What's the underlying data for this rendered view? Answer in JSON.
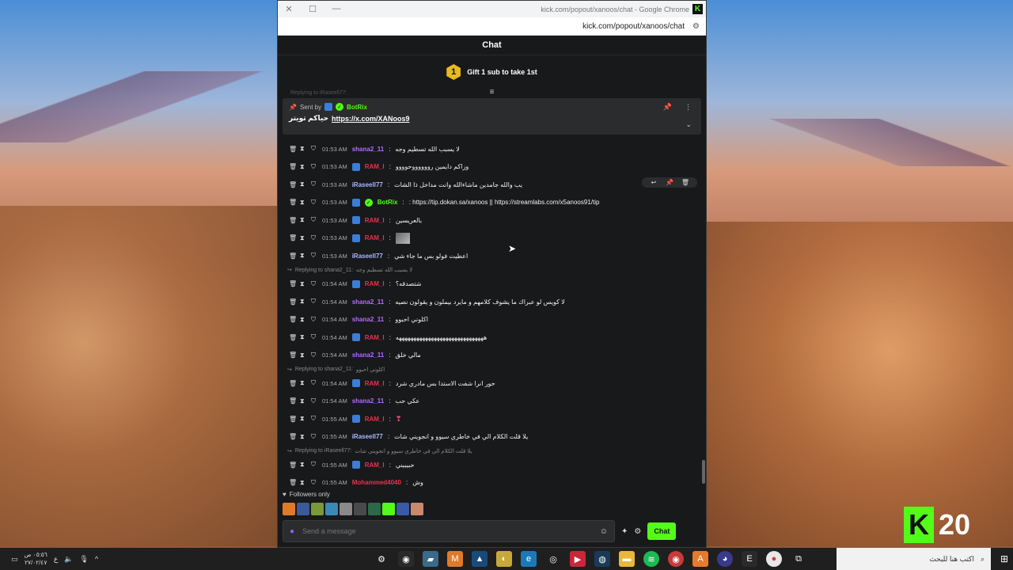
{
  "window": {
    "title": "kick.com/popout/xanoos/chat - Google Chrome",
    "url": "kick.com/popout/xanoos/chat",
    "controls": {
      "close": "✕",
      "maximize": "☐",
      "minimize": "—"
    }
  },
  "chat": {
    "header": "Chat",
    "gift": {
      "badge": "1",
      "text": "Gift 1 sub to take 1st"
    },
    "pinned": {
      "ghost": "Replying to iRaseell77:",
      "sent_by": "Sent by",
      "sender": "BotRix",
      "message_ar": "حياكم تويتر",
      "link": "https://x.com/XANoos9"
    },
    "messages": [
      {
        "type": "msg",
        "time": "01:53 AM",
        "user": "shana2_11",
        "color": "#b36bff",
        "text": "لا يسبب الله تسطيم وجه",
        "badge": false
      },
      {
        "type": "msg",
        "time": "01:53 AM",
        "user": "RAM_I",
        "color": "#e8324e",
        "text": "وزاكم دايمين رووووووحوووو",
        "badge": true
      },
      {
        "type": "msg",
        "time": "01:53 AM",
        "user": "iRaseell77",
        "color": "#aab8ff",
        "text": "يب والله جامدين ماشاءالله وانت مداخل ذا الشات",
        "badge": false,
        "hover": true
      },
      {
        "type": "msg",
        "time": "01:53 AM",
        "user": "BotRix",
        "color": "#53fc18",
        "text": ": https://tip.dokan.sa/xanoos || https://streamlabs.com/x5anoos91/tip",
        "badge": true,
        "bot": true
      },
      {
        "type": "msg",
        "time": "01:53 AM",
        "user": "RAM_I",
        "color": "#e8324e",
        "text": "بالعريسين",
        "badge": true
      },
      {
        "type": "msg",
        "time": "01:53 AM",
        "user": "RAM_I",
        "color": "#e8324e",
        "text": "",
        "badge": true,
        "emote": true
      },
      {
        "type": "msg",
        "time": "01:53 AM",
        "user": "iRaseell77",
        "color": "#aab8ff",
        "text": "اعطيت فولو بس ما جاء شي",
        "badge": false
      },
      {
        "type": "reply",
        "text": "Replying to shana2_11:",
        "quote": "لا يسبب الله تسطيم وجه"
      },
      {
        "type": "msg",
        "time": "01:54 AM",
        "user": "RAM_I",
        "color": "#e8324e",
        "text": "شتصدقه؟",
        "badge": true
      },
      {
        "type": "msg",
        "time": "01:54 AM",
        "user": "shana2_11",
        "color": "#b36bff",
        "text": "لا كويس لو عبراك ما يشوف كلامهم و مايرد بيملون و يقولون نصيه",
        "badge": false
      },
      {
        "type": "msg",
        "time": "01:54 AM",
        "user": "shana2_11",
        "color": "#b36bff",
        "text": "اكلوني احبوو",
        "badge": false
      },
      {
        "type": "msg",
        "time": "01:54 AM",
        "user": "RAM_I",
        "color": "#e8324e",
        "text": "ههههههههههههههههههههههههههههههه",
        "badge": true
      },
      {
        "type": "msg",
        "time": "01:54 AM",
        "user": "shana2_11",
        "color": "#b36bff",
        "text": "مالي خلق",
        "badge": false
      },
      {
        "type": "reply",
        "text": "Replying to shana2_11:",
        "quote": "اكلوني احبوو"
      },
      {
        "type": "msg",
        "time": "01:54 AM",
        "user": "RAM_I",
        "color": "#e8324e",
        "text": "حور انرا شفت الاستدا بس مادري شرد",
        "badge": true
      },
      {
        "type": "msg",
        "time": "01:54 AM",
        "user": "shana2_11",
        "color": "#b36bff",
        "text": "عكي حب",
        "badge": false
      },
      {
        "type": "msg",
        "time": "01:55 AM",
        "user": "RAM_I",
        "color": "#e8324e",
        "text": "❣",
        "badge": true,
        "heart": true
      },
      {
        "type": "msg",
        "time": "01:55 AM",
        "user": "iRaseell77",
        "color": "#aab8ff",
        "text": "يلا قلت الكلام الي في خاطري سيوو و انجويني شات",
        "badge": false
      },
      {
        "type": "reply",
        "text": "Replying to iRaseell77:",
        "quote": "يلا قلت الكلام الي في خاطري سيوو و انجويني شات"
      },
      {
        "type": "msg",
        "time": "01:55 AM",
        "user": "RAM_I",
        "color": "#e8324e",
        "text": "حبيبيني",
        "badge": true
      },
      {
        "type": "msg",
        "time": "01:55 AM",
        "user": "Mohammed4040",
        "color": "#e8324e",
        "text": "وش",
        "badge": false
      }
    ],
    "followers_label": "Followers only",
    "input_placeholder": "Send a message",
    "send_label": "Chat"
  },
  "overlay": {
    "logo": "K",
    "count": "20"
  },
  "taskbar": {
    "clock_time": "٠٥:٥٦ ص",
    "clock_date": "٢٧/٠٢/٤٧",
    "lang": "ع",
    "search_placeholder": "اكتب هنا للبحث"
  },
  "colors": {
    "accent": "#53fc18",
    "bg": "#18191b"
  }
}
